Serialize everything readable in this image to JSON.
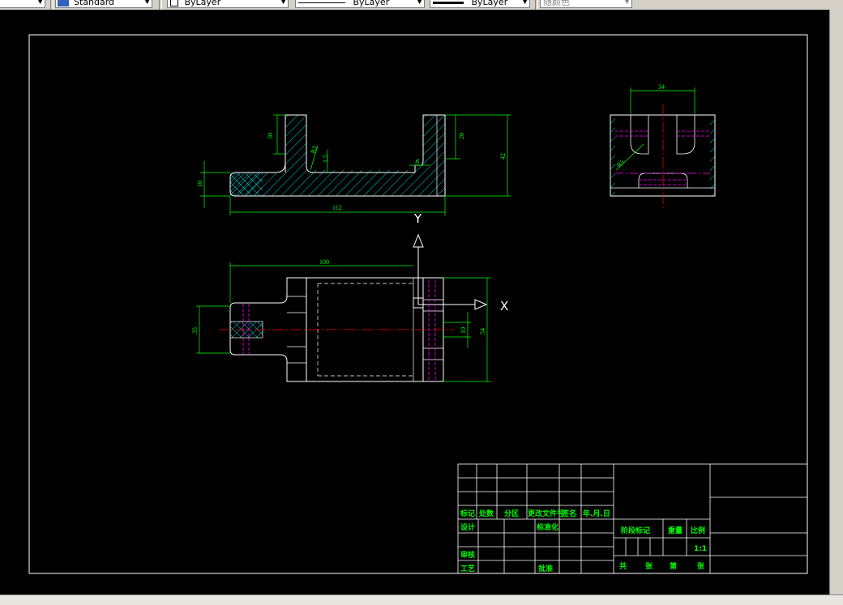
{
  "toolbar": {
    "text_style": "Standard",
    "layer": "ByLayer",
    "linetype": "ByLayer",
    "lineweight": "ByLayer",
    "color": "随颜色"
  },
  "drawing": {
    "front_view": {
      "dim_30_left": "30",
      "dim_20_right": "20",
      "dim_42": "42",
      "dim_10": "10",
      "dim_112": "112",
      "dim_r3": "R3",
      "dim_1_5": "1.5",
      "dim_6": "6"
    },
    "side_view": {
      "dim_34": "34",
      "dim_r5": "R5"
    },
    "top_view": {
      "dim_100": "100",
      "dim_35": "35",
      "dim_10": "10",
      "dim_54": "54"
    },
    "axis_y": "Y",
    "axis_x": "X"
  },
  "title_block": {
    "mark": "标记",
    "count": "处数",
    "zone": "分区",
    "change_doc": "更改文件号",
    "sign": "签名",
    "date": "年.月.日",
    "design": "设计",
    "standardize": "标准化",
    "review": "审核",
    "process": "工艺",
    "approve": "批准",
    "stage_mark": "阶段标记",
    "weight": "重量",
    "scale": "比例",
    "scale_value": "1:1",
    "total": "共",
    "sheets": "张",
    "sheet_no": "第",
    "sheet_unit": "张"
  }
}
